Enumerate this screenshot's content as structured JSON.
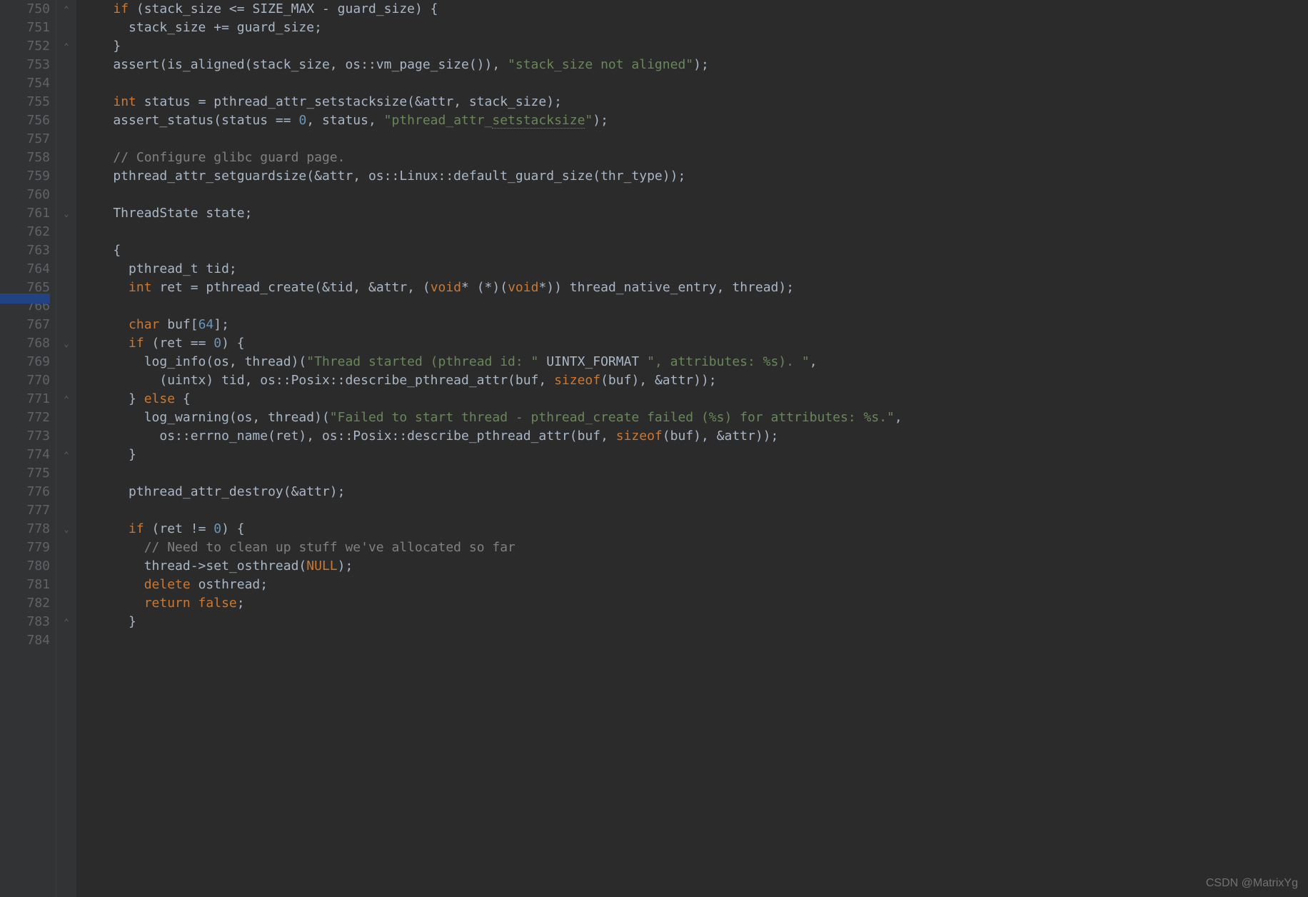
{
  "watermark": "CSDN @MatrixYg",
  "first_line_no": 750,
  "fold_marks": {
    "750": "⌃",
    "752": "⌃",
    "761": "⌄",
    "768": "⌄",
    "771": "⌃",
    "774": "⌃",
    "778": "⌄",
    "783": "⌃"
  },
  "code": [
    {
      "tokens": [
        {
          "t": "    "
        },
        {
          "t": "if",
          "c": "k"
        },
        {
          "t": " (stack_size <= SIZE_MAX - guard_size) {"
        }
      ]
    },
    {
      "tokens": [
        {
          "t": "      stack_size += guard_size;"
        }
      ]
    },
    {
      "tokens": [
        {
          "t": "    }"
        }
      ]
    },
    {
      "tokens": [
        {
          "t": "    assert(is_aligned(stack_size, os::vm_page_size()), "
        },
        {
          "t": "\"stack_size not aligned\"",
          "c": "s"
        },
        {
          "t": ");"
        }
      ]
    },
    {
      "tokens": [
        {
          "t": ""
        }
      ]
    },
    {
      "tokens": [
        {
          "t": "    "
        },
        {
          "t": "int",
          "c": "k"
        },
        {
          "t": " status = pthread_attr_setstacksize(&attr, stack_size);"
        }
      ]
    },
    {
      "tokens": [
        {
          "t": "    assert_status(status == "
        },
        {
          "t": "0",
          "c": "n"
        },
        {
          "t": ", status, "
        },
        {
          "t": "\"pthread_attr_",
          "c": "s"
        },
        {
          "t": "setstacksize",
          "c": "s underline"
        },
        {
          "t": "\"",
          "c": "s"
        },
        {
          "t": ");"
        }
      ]
    },
    {
      "tokens": [
        {
          "t": ""
        }
      ]
    },
    {
      "tokens": [
        {
          "t": "    "
        },
        {
          "t": "// Configure glibc guard page.",
          "c": "c"
        }
      ]
    },
    {
      "tokens": [
        {
          "t": "    pthread_attr_setguardsize(&attr, os::Linux::default_guard_size(thr_type));"
        }
      ]
    },
    {
      "tokens": [
        {
          "t": ""
        }
      ]
    },
    {
      "tokens": [
        {
          "t": "    ThreadState state;"
        }
      ]
    },
    {
      "tokens": [
        {
          "t": ""
        }
      ]
    },
    {
      "tokens": [
        {
          "t": "    {"
        }
      ]
    },
    {
      "tokens": [
        {
          "t": "      pthread_t tid;"
        }
      ]
    },
    {
      "tokens": [
        {
          "t": "      "
        },
        {
          "t": "int",
          "c": "k"
        },
        {
          "t": " ret = pthread_create(&tid, &attr, ("
        },
        {
          "t": "void",
          "c": "k"
        },
        {
          "t": "* (*)("
        },
        {
          "t": "void",
          "c": "k"
        },
        {
          "t": "*)) thread_native_entry, thread);"
        }
      ]
    },
    {
      "tokens": [
        {
          "t": ""
        }
      ]
    },
    {
      "tokens": [
        {
          "t": "      "
        },
        {
          "t": "char",
          "c": "k"
        },
        {
          "t": " buf["
        },
        {
          "t": "64",
          "c": "n"
        },
        {
          "t": "];"
        }
      ]
    },
    {
      "tokens": [
        {
          "t": "      "
        },
        {
          "t": "if",
          "c": "k"
        },
        {
          "t": " (ret == "
        },
        {
          "t": "0",
          "c": "n"
        },
        {
          "t": ") {"
        }
      ]
    },
    {
      "tokens": [
        {
          "t": "        log_info(os, thread)("
        },
        {
          "t": "\"Thread started (pthread id: \"",
          "c": "s"
        },
        {
          "t": " UINTX_FORMAT "
        },
        {
          "t": "\", attributes: %s). \"",
          "c": "s"
        },
        {
          "t": ","
        }
      ]
    },
    {
      "tokens": [
        {
          "t": "          (uintx) tid, os::Posix::describe_pthread_attr(buf, "
        },
        {
          "t": "sizeof",
          "c": "k"
        },
        {
          "t": "(buf), &attr));"
        }
      ]
    },
    {
      "tokens": [
        {
          "t": "      } "
        },
        {
          "t": "else",
          "c": "k"
        },
        {
          "t": " {"
        }
      ]
    },
    {
      "tokens": [
        {
          "t": "        log_warning(os, thread)("
        },
        {
          "t": "\"Failed to start thread - pthread_create failed (%s) for attributes: %s.\"",
          "c": "s"
        },
        {
          "t": ","
        }
      ]
    },
    {
      "tokens": [
        {
          "t": "          os::errno_name(ret), os::Posix::describe_pthread_attr(buf, "
        },
        {
          "t": "sizeof",
          "c": "k"
        },
        {
          "t": "(buf), &attr));"
        }
      ]
    },
    {
      "tokens": [
        {
          "t": "      }"
        }
      ]
    },
    {
      "tokens": [
        {
          "t": ""
        }
      ]
    },
    {
      "tokens": [
        {
          "t": "      pthread_attr_destroy(&attr);"
        }
      ]
    },
    {
      "tokens": [
        {
          "t": ""
        }
      ]
    },
    {
      "tokens": [
        {
          "t": "      "
        },
        {
          "t": "if",
          "c": "k"
        },
        {
          "t": " (ret != "
        },
        {
          "t": "0",
          "c": "n"
        },
        {
          "t": ") {"
        }
      ]
    },
    {
      "tokens": [
        {
          "t": "        "
        },
        {
          "t": "// Need to clean up stuff we've allocated so far",
          "c": "c"
        }
      ]
    },
    {
      "tokens": [
        {
          "t": "        thread->set_osthread("
        },
        {
          "t": "NULL",
          "c": "k"
        },
        {
          "t": ");"
        }
      ]
    },
    {
      "tokens": [
        {
          "t": "        "
        },
        {
          "t": "delete",
          "c": "k"
        },
        {
          "t": " osthread;"
        }
      ]
    },
    {
      "tokens": [
        {
          "t": "        "
        },
        {
          "t": "return false",
          "c": "k"
        },
        {
          "t": ";"
        }
      ]
    },
    {
      "tokens": [
        {
          "t": "      }"
        }
      ]
    },
    {
      "tokens": [
        {
          "t": ""
        }
      ]
    }
  ]
}
